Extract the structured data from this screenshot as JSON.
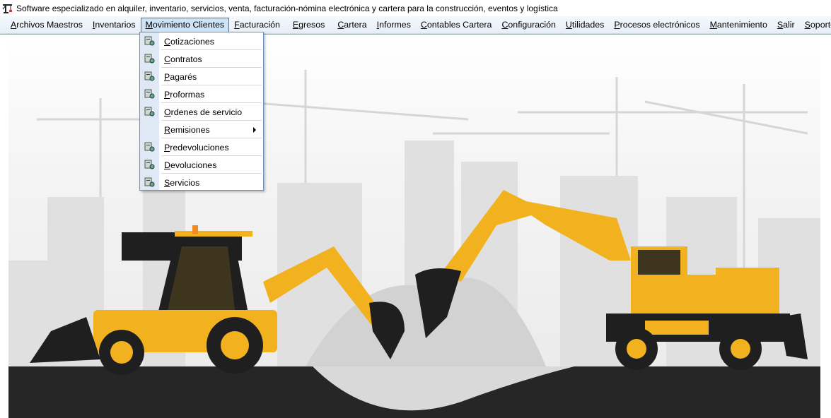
{
  "window": {
    "title": "Software especializado en alquiler, inventario, servicios, venta, facturación-nómina electrónica y cartera para la construcción, eventos y logística",
    "icon": "crane-app-icon"
  },
  "menubar": {
    "items": [
      {
        "label": "Archivos Maestros",
        "mnemonic": "A",
        "rest": "rchivos Maestros"
      },
      {
        "label": "Inventarios",
        "mnemonic": "I",
        "rest": "nventarios"
      },
      {
        "label": "Movimiento Clientes",
        "mnemonic": "M",
        "rest": "ovimiento Clientes",
        "active": true
      },
      {
        "label": "Facturación",
        "mnemonic": "F",
        "rest": "acturación"
      },
      {
        "label": "Egresos",
        "mnemonic": "E",
        "rest": "gresos"
      },
      {
        "label": "Cartera",
        "mnemonic": "C",
        "rest": "artera"
      },
      {
        "label": "Informes",
        "mnemonic": "I",
        "rest": "nformes"
      },
      {
        "label": "Contables Cartera",
        "mnemonic": "C",
        "rest": "ontables Cartera"
      },
      {
        "label": "Configuración",
        "mnemonic": "C",
        "rest": "onfiguración"
      },
      {
        "label": "Utilidades",
        "mnemonic": "U",
        "rest": "tilidades"
      },
      {
        "label": "Procesos electrónicos",
        "mnemonic": "P",
        "rest": "rocesos electrónicos"
      },
      {
        "label": "Mantenimiento",
        "mnemonic": "M",
        "rest": "antenimiento"
      },
      {
        "label": "Salir",
        "mnemonic": "S",
        "rest": "alir"
      },
      {
        "label": "Soporte",
        "mnemonic": "S",
        "rest": "oporte"
      }
    ]
  },
  "dropdown": {
    "items": [
      {
        "mnemonic": "C",
        "rest": "otizaciones",
        "icon": "document-gear-icon",
        "submenu": false
      },
      {
        "mnemonic": "C",
        "rest": "ontratos",
        "icon": "document-gear-icon",
        "submenu": false
      },
      {
        "mnemonic": "P",
        "rest": "agarés",
        "icon": "document-gear-icon",
        "submenu": false
      },
      {
        "mnemonic": "P",
        "rest": "roformas",
        "icon": "document-gear-icon",
        "submenu": false
      },
      {
        "mnemonic": "O",
        "rest": "rdenes de servicio",
        "icon": "document-gear-icon",
        "submenu": false
      },
      {
        "mnemonic": "R",
        "rest": "emisiones",
        "icon": "",
        "submenu": true
      },
      {
        "mnemonic": "P",
        "rest": "redevoluciones",
        "icon": "document-gear-icon",
        "submenu": false
      },
      {
        "mnemonic": "D",
        "rest": "evoluciones",
        "icon": "document-gear-icon",
        "submenu": false
      },
      {
        "mnemonic": "S",
        "rest": "ervicios",
        "icon": "document-gear-icon",
        "submenu": false
      }
    ]
  },
  "colors": {
    "machine_yellow": "#f2b21f",
    "machine_dark": "#1f1f1f",
    "ground": "#262626",
    "skyline": "#e3e3e3"
  }
}
